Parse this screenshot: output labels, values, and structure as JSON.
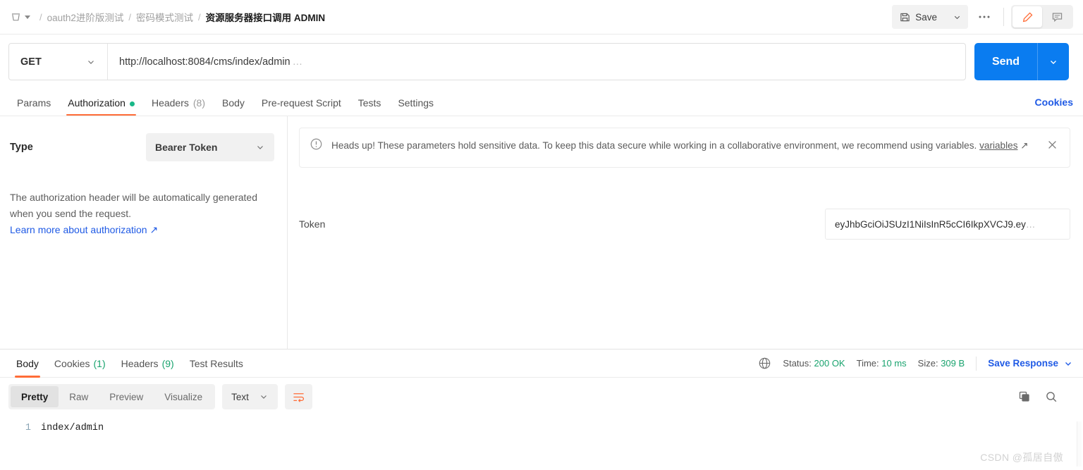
{
  "breadcrumb": {
    "collection_icon": "collection-cup-icon",
    "items": [
      {
        "label": "oauth2进阶版测试",
        "current": false
      },
      {
        "label": "密码模式测试",
        "current": false
      },
      {
        "label": "资源服务器接口调用 ADMIN",
        "current": true
      }
    ],
    "separator": "/"
  },
  "toolbar": {
    "save_label": "Save",
    "save_icon": "floppy-disk-icon",
    "save_caret_icon": "chevron-down-icon",
    "more_icon": "ellipsis-icon",
    "edit_icon": "pencil-icon",
    "comment_icon": "comment-icon"
  },
  "request": {
    "method": "GET",
    "method_caret_icon": "chevron-down-icon",
    "url": "http://localhost:8084/cms/index/admin",
    "url_ellipsis": "…",
    "url_placeholder": "Enter request URL",
    "send_label": "Send",
    "send_caret_icon": "chevron-down-icon",
    "send_color": "#0a7cf0"
  },
  "request_tabs": {
    "items": [
      {
        "label": "Params",
        "count": "",
        "active": false,
        "dot": false
      },
      {
        "label": "Authorization",
        "count": "",
        "active": true,
        "dot": true
      },
      {
        "label": "Headers",
        "count": "(8)",
        "active": false,
        "dot": false
      },
      {
        "label": "Body",
        "count": "",
        "active": false,
        "dot": false
      },
      {
        "label": "Pre-request Script",
        "count": "",
        "active": false,
        "dot": false
      },
      {
        "label": "Tests",
        "count": "",
        "active": false,
        "dot": false
      },
      {
        "label": "Settings",
        "count": "",
        "active": false,
        "dot": false
      }
    ],
    "cookies_label": "Cookies",
    "accent_color": "#ff6c37",
    "dot_color": "#19b888"
  },
  "authorization": {
    "type_label": "Type",
    "type_value": "Bearer Token",
    "type_caret_icon": "chevron-down-icon",
    "description": "The authorization header will be automatically generated when you send the request.",
    "learn_more": "Learn more about authorization",
    "external_link_icon": "external-link-arrow-icon",
    "banner": {
      "icon": "alert-circle-icon",
      "text": "Heads up! These parameters hold sensitive data. To keep this data secure while working in a collaborative environment, we recommend using variables.",
      "link_label": "variables",
      "link_icon": "external-link-arrow-icon",
      "close_icon": "close-icon"
    },
    "token_label": "Token",
    "token_value": "eyJhbGciOiJSUzI1NiIsInR5cCI6IkpXVCJ9.ey",
    "token_ellipsis": "…",
    "token_placeholder": "Token"
  },
  "response": {
    "tabs": [
      {
        "label": "Body",
        "count": "",
        "active": true
      },
      {
        "label": "Cookies",
        "count": "(1)",
        "active": false
      },
      {
        "label": "Headers",
        "count": "(9)",
        "active": false
      },
      {
        "label": "Test Results",
        "count": "",
        "active": false
      }
    ],
    "globe_icon": "globe-icon",
    "status_label": "Status:",
    "status_value": "200 OK",
    "time_label": "Time:",
    "time_value": "10 ms",
    "size_label": "Size:",
    "size_value": "309 B",
    "save_response_label": "Save Response",
    "save_response_caret_icon": "chevron-down-icon",
    "status_color": "#19a36e",
    "format_tabs": [
      {
        "label": "Pretty",
        "active": true
      },
      {
        "label": "Raw",
        "active": false
      },
      {
        "label": "Preview",
        "active": false
      },
      {
        "label": "Visualize",
        "active": false
      }
    ],
    "content_type": "Text",
    "content_type_caret_icon": "chevron-down-icon",
    "wrap_icon": "word-wrap-icon",
    "copy_icon": "copy-icon",
    "search_icon": "search-icon",
    "body_lines": [
      {
        "number": "1",
        "text": "index/admin"
      }
    ]
  },
  "watermark": "CSDN @孤居自傲"
}
